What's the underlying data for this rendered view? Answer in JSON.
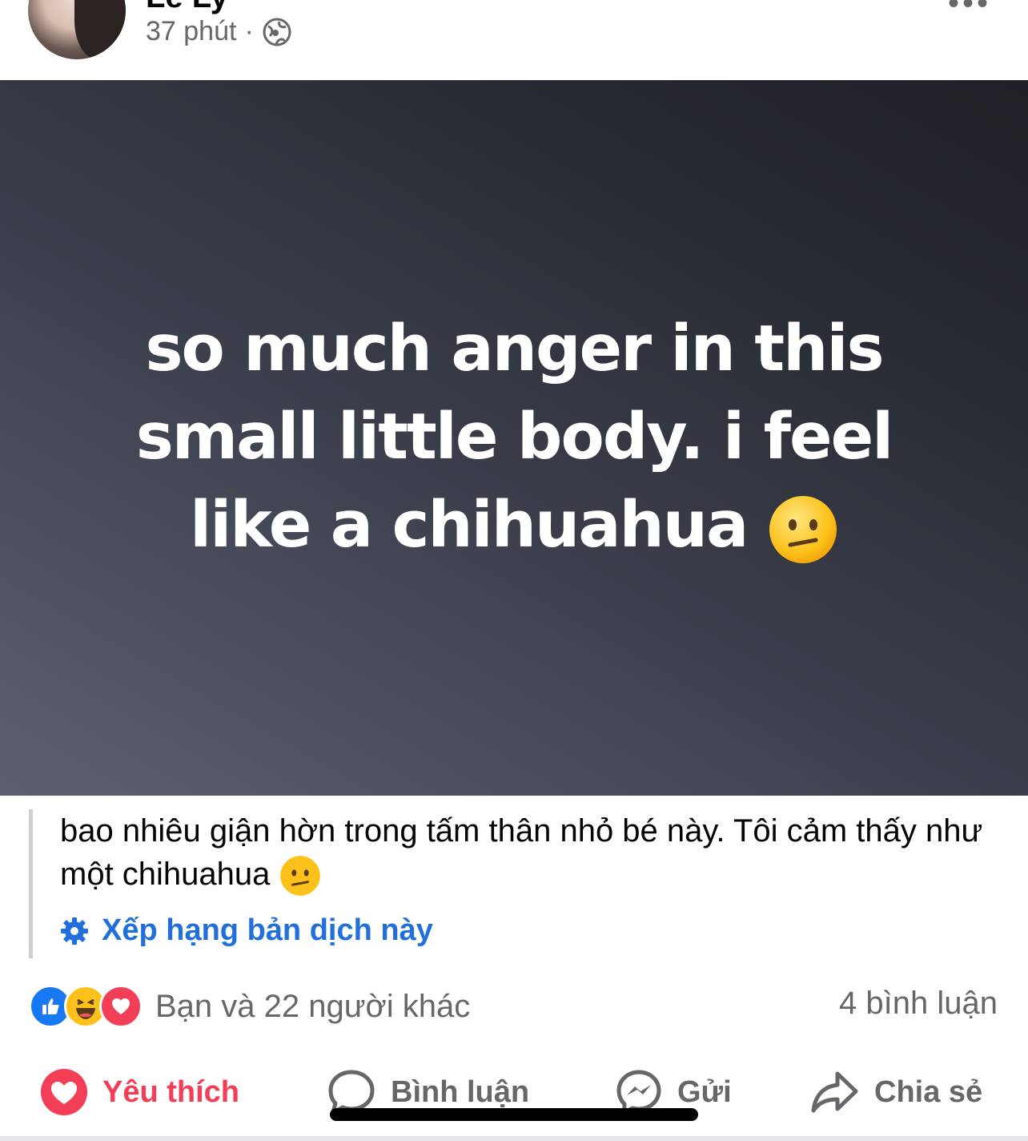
{
  "post": {
    "author_name_clipped": "Lê Ly",
    "time": "37 phút",
    "separator": "·",
    "more_icon": "more-dots-icon",
    "privacy_icon": "globe-icon",
    "image_text": "so much anger in this small little body. i feel like a chihuahua",
    "image_emoji": "confused-face-emoji",
    "image_background": [
      "#5c6072",
      "#1f2026"
    ]
  },
  "translation": {
    "text": "bao nhiêu giận hờn trong tấm thân nhỏ bé này. Tôi cảm thấy như một chihuahua",
    "rate_label": "Xếp hạng bản dịch này",
    "rate_icon": "gear-icon"
  },
  "engagement": {
    "reactions": [
      "like-reaction-icon",
      "haha-reaction-icon",
      "love-reaction-icon"
    ],
    "reactions_text": "Bạn và 22 người khác",
    "comments_text": "4 bình luận"
  },
  "actions": {
    "like": "Yêu thích",
    "comment": "Bình luận",
    "send": "Gửi",
    "share": "Chia sẻ"
  },
  "colors": {
    "accent_blue": "#216fdb",
    "love_red": "#f33e58",
    "secondary_text": "#65676b"
  }
}
